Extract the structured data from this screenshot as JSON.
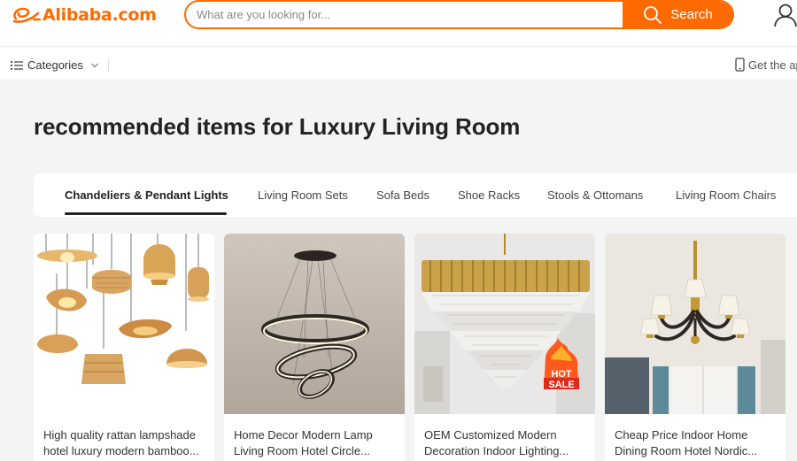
{
  "header": {
    "logo_text": "Alibaba.com",
    "search_placeholder": "What are you looking for...",
    "search_label": "Search",
    "brand_color": "#ff6a00"
  },
  "subnav": {
    "categories_label": "Categories",
    "get_app_label": "Get the ap"
  },
  "page": {
    "title": "recommended items for Luxury Living Room"
  },
  "tabs": [
    {
      "label": "Chandeliers & Pendant Lights",
      "active": true
    },
    {
      "label": "Living Room Sets",
      "active": false
    },
    {
      "label": "Sofa Beds",
      "active": false
    },
    {
      "label": "Shoe Racks",
      "active": false
    },
    {
      "label": "Stools & Ottomans",
      "active": false
    },
    {
      "label": "Living Room Chairs",
      "active": false
    }
  ],
  "products": [
    {
      "title_line1": "High quality rattan lampshade",
      "title_line2": "hotel luxury modern bamboo...",
      "image": "rattan-pendant-lamps-image"
    },
    {
      "title_line1": "Home Decor Modern Lamp",
      "title_line2": "Living Room Hotel Circle...",
      "image": "ring-chandelier-image"
    },
    {
      "title_line1": "OEM Customized Modern",
      "title_line2": "Decoration Indoor Lighting...",
      "image": "crystal-chandelier-image",
      "badge_line1": "HOT",
      "badge_line2": "SALE"
    },
    {
      "title_line1": "Cheap Price Indoor Home",
      "title_line2": "Dining Room Hotel Nordic...",
      "image": "nordic-chandelier-image"
    }
  ]
}
